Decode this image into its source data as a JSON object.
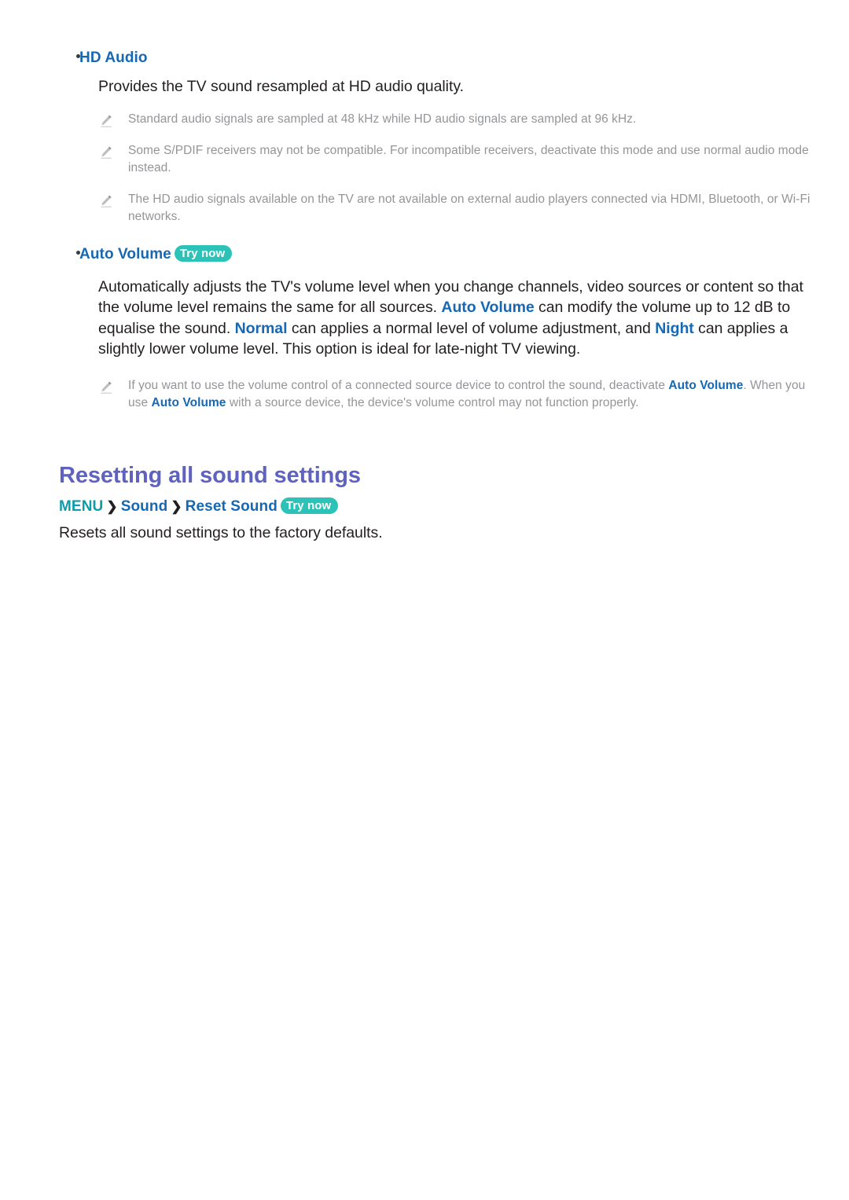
{
  "document": {
    "sections": [
      {
        "bullet_label": "HD Audio",
        "body": {
          "prefix": "Provides the TV sound resampled at HD audio quality."
        },
        "notes": [
          "Standard audio signals are sampled at 48 kHz while HD audio signals are sampled at 96 kHz.",
          "Some S/PDIF receivers may not be compatible. For incompatible receivers, deactivate this mode and use normal audio mode instead.",
          "The HD audio signals available on the TV are not available on external audio players connected via HDMI, Bluetooth, or Wi-Fi networks."
        ]
      },
      {
        "bullet_label": "Auto Volume",
        "try_now": "Try now",
        "paragraph": {
          "p1": "Automatically adjusts the TV's volume level when you change channels, video sources or content so that the volume level remains the same for all sources. ",
          "kw1": "Auto Volume",
          "p2": " can modify the volume up to 12 dB to equalise the sound. ",
          "kw2": "Normal",
          "p3": " can applies a normal level of volume adjustment, and ",
          "kw3": "Night",
          "p4": " can applies a slightly lower volume level. This option is ideal for late-night TV viewing."
        },
        "note": {
          "n1": "If you want to use the volume control of a connected source device to control the sound, deactivate ",
          "kw1": "Auto Volume",
          "n2": ". When you use ",
          "kw2": "Auto Volume",
          "n3": " with a source device, the device's volume control may not function properly."
        }
      }
    ],
    "reset_section": {
      "title": "Resetting all sound settings",
      "breadcrumb": {
        "root": "MENU",
        "sep1": "❯",
        "item1": "Sound",
        "sep2": "❯",
        "item2": "Reset Sound",
        "try_now": "Try now"
      },
      "description": "Resets all sound settings to the factory defaults."
    }
  },
  "icons": {
    "note_icon": "pencil-icon",
    "bullet_icon": "bullet-dot-icon"
  },
  "colors": {
    "link_blue": "#1668b3",
    "heading_purple": "#5f62bf",
    "badge_teal": "#2cc2b8",
    "menu_teal": "#0d9caa",
    "note_gray": "#939598",
    "body_black": "#231f20"
  }
}
